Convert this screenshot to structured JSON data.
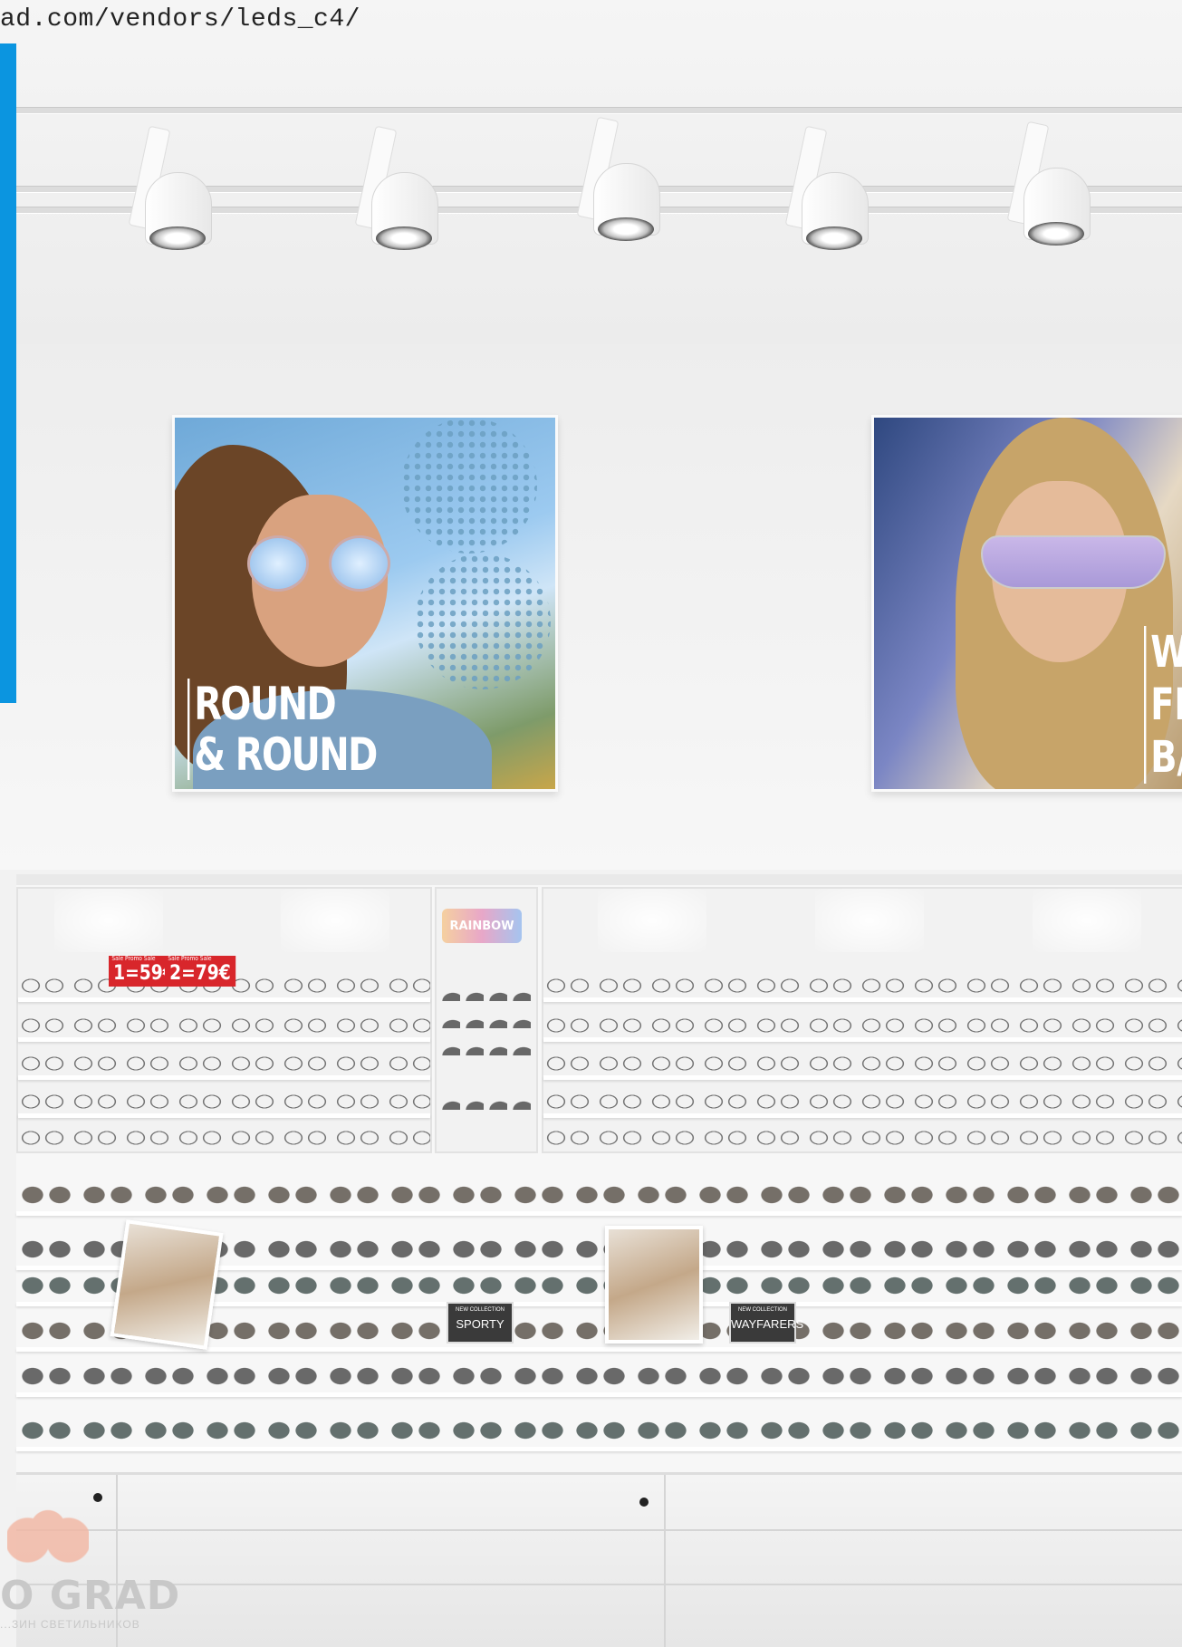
{
  "url_text": "ad.com/vendors/leds_c4/",
  "posters": {
    "left_title_line1": "ROUND",
    "left_title_line2": "& ROUND",
    "right_title_line1": "W",
    "right_title_line2": "FL",
    "right_title_line3": "B/"
  },
  "price_tags": [
    {
      "label": "1=59€",
      "small": "Sale Promo Sale"
    },
    {
      "label": "2=79€",
      "small": "Sale Promo Sale"
    }
  ],
  "rainbow_sign": "RAINBOW",
  "collection_signs": [
    {
      "small": "NEW COLLECTION",
      "name": "SPORTY"
    },
    {
      "small": "NEW COLLECTION",
      "name": "WAYFARERS"
    }
  ],
  "watermark": {
    "brand": "O GRAD",
    "tagline": "...ЗИН СВЕТИЛЬНИКОВ"
  },
  "colors": {
    "accent_blue": "#0b95e0",
    "price_red": "#d8262b"
  }
}
